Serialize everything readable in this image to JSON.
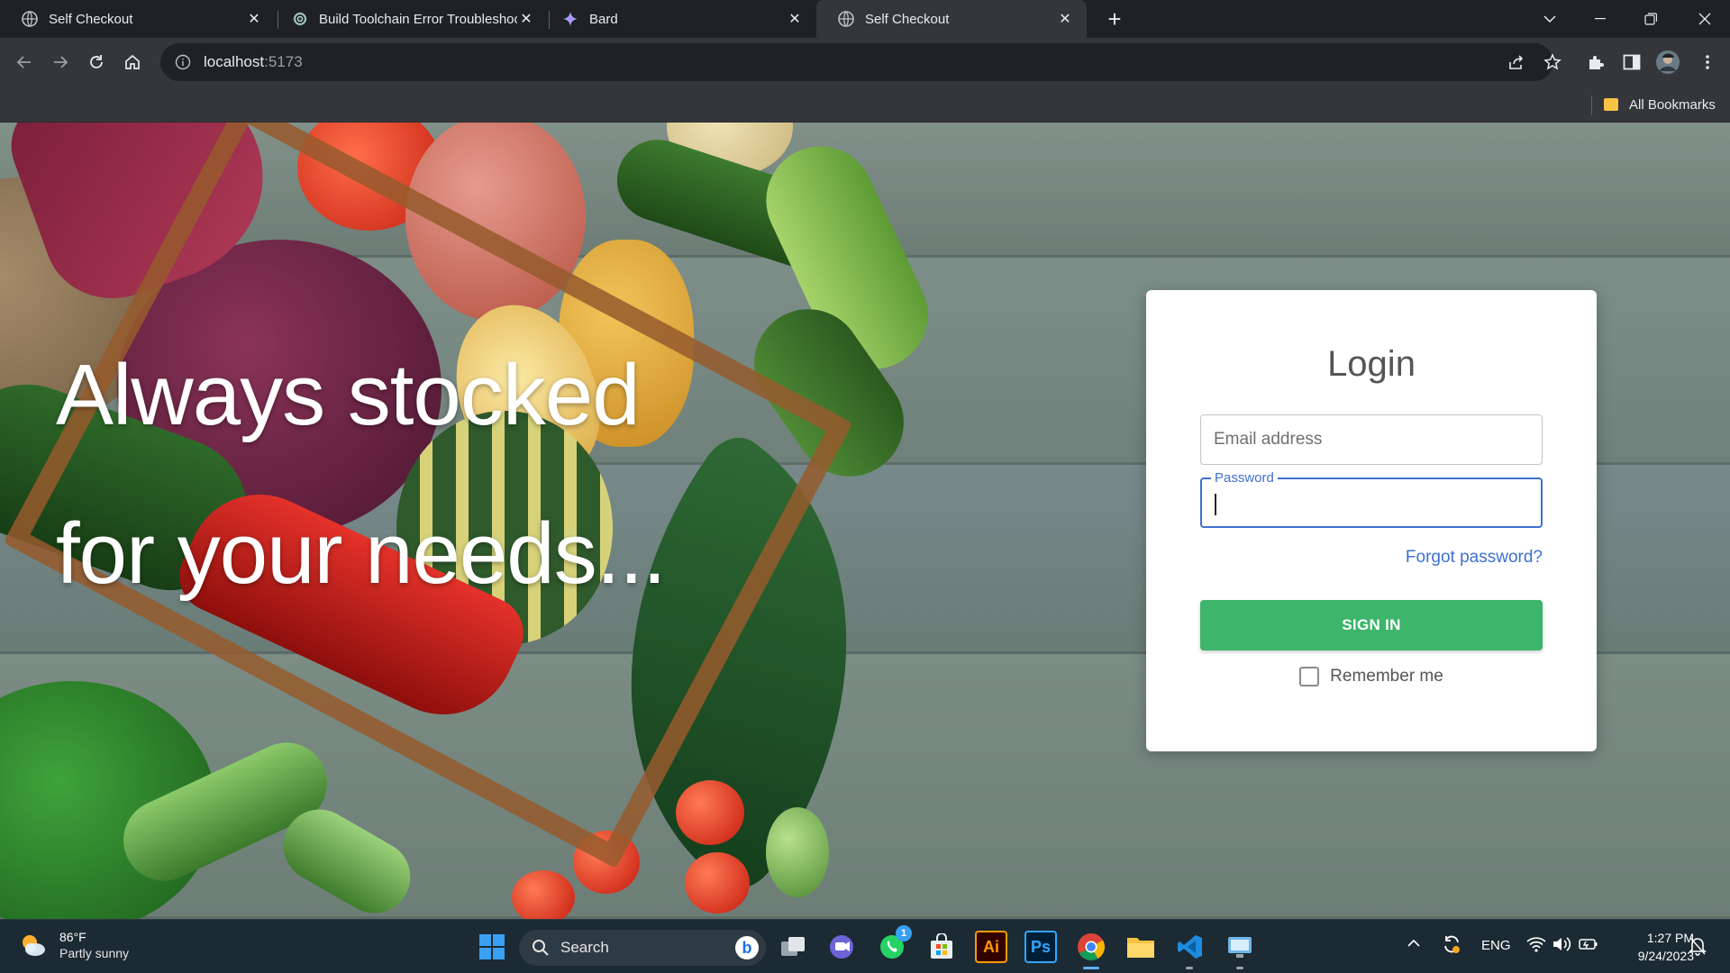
{
  "browser": {
    "tabs": [
      {
        "title": "Self Checkout",
        "active": false
      },
      {
        "title": "Build Toolchain Error Troubleshooting",
        "active": false
      },
      {
        "title": "Bard",
        "active": false
      },
      {
        "title": "Self Checkout",
        "active": true
      }
    ],
    "url": {
      "host": "localhost",
      "port": ":5173"
    },
    "bookmarks": {
      "all_label": "All Bookmarks"
    }
  },
  "hero": {
    "line1": "Always stocked",
    "line2": "for your needs..."
  },
  "login": {
    "title": "Login",
    "email_placeholder": "Email address",
    "password_label": "Password",
    "forgot": "Forgot password?",
    "signin": "SIGN IN",
    "remember": "Remember me",
    "accent_color": "#3f6fd1",
    "button_color": "#3db56a"
  },
  "taskbar": {
    "weather_temp": "86°F",
    "weather_desc": "Partly sunny",
    "search_label": "Search",
    "whatsapp_badge": "1",
    "language": "ENG",
    "time": "1:27 PM",
    "date": "9/24/2023"
  }
}
